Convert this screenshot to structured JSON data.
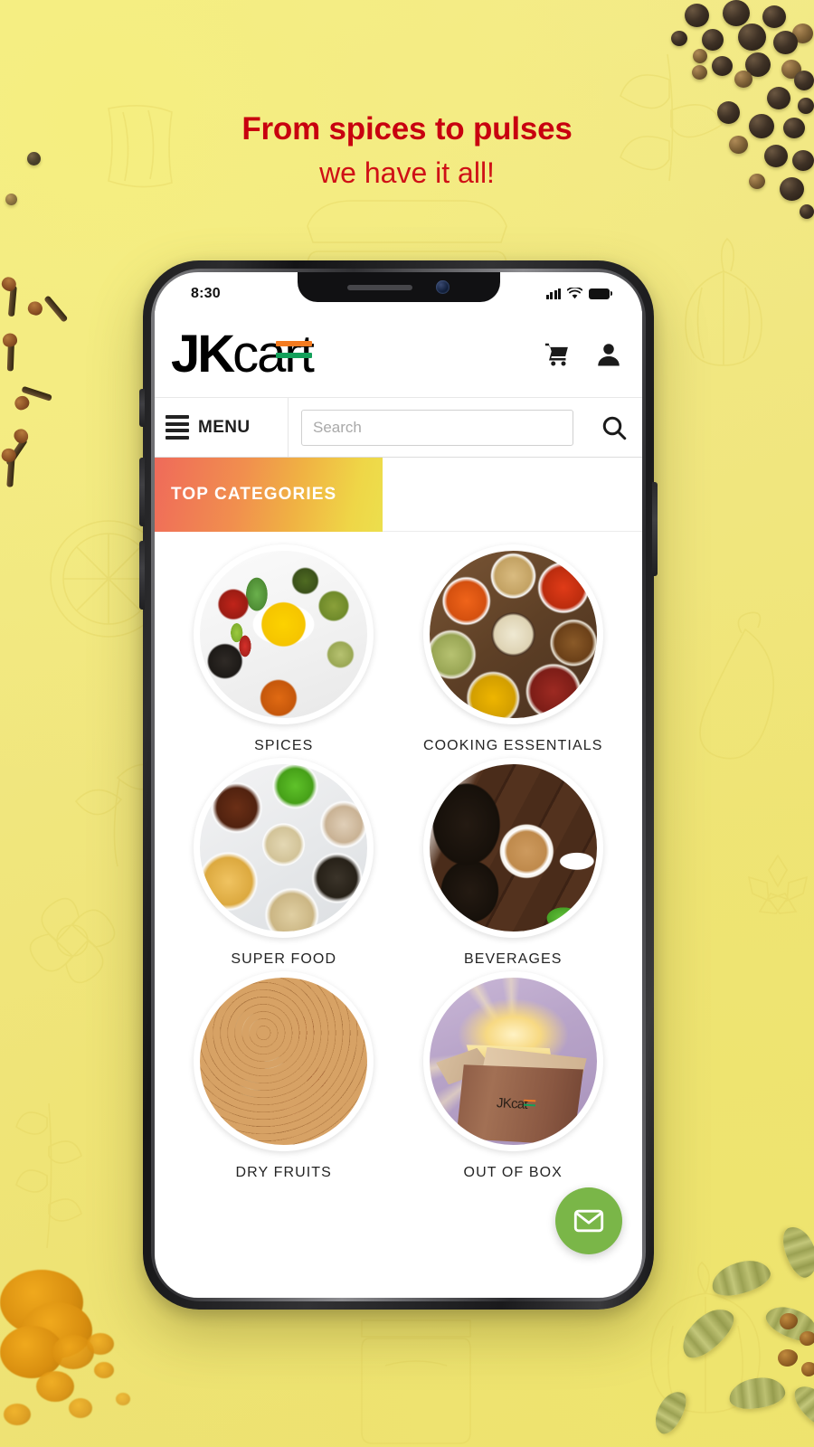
{
  "promo": {
    "headline": "From spices to pulses",
    "subheadline": "we have it all!",
    "headline_color": "#c8000f",
    "background_color": "#f1e781"
  },
  "phone": {
    "status_bar": {
      "time": "8:30",
      "signal_icon": "cellular-signal-icon",
      "wifi_icon": "wifi-icon",
      "battery_icon": "battery-full-icon"
    }
  },
  "app": {
    "logo": {
      "text_part1": "JK",
      "text_part2": "ca",
      "text_part3": "t",
      "flag_colors": {
        "saffron": "#f47b20",
        "green": "#13a05a"
      }
    },
    "header": {
      "cart_icon": "shopping-cart-icon",
      "account_icon": "user-account-icon"
    },
    "menu": {
      "label": "MENU",
      "icon": "hamburger-menu-icon"
    },
    "search": {
      "placeholder": "Search",
      "value": "",
      "submit_icon": "search-icon"
    },
    "section": {
      "title": "TOP CATEGORIES",
      "gradient_from": "#ef6a5a",
      "gradient_to": "#ecdf4d"
    },
    "categories": [
      {
        "label": "SPICES",
        "image": "assorted-spices-in-white-bowls"
      },
      {
        "label": "COOKING ESSENTIALS",
        "image": "grains-and-lentils-in-bowls"
      },
      {
        "label": "SUPER FOOD",
        "image": "superfood-seeds-and-grains"
      },
      {
        "label": "BEVERAGES",
        "image": "cup-of-tea-with-tea-leaves"
      },
      {
        "label": "DRY FRUITS",
        "image": "mixed-nuts-in-wooden-bowl"
      },
      {
        "label": "OUT OF BOX",
        "image": "glowing-open-cardboard-box"
      }
    ],
    "box_logo_text": "JKcat",
    "fab": {
      "icon": "envelope-icon",
      "color": "#7ab648"
    }
  }
}
